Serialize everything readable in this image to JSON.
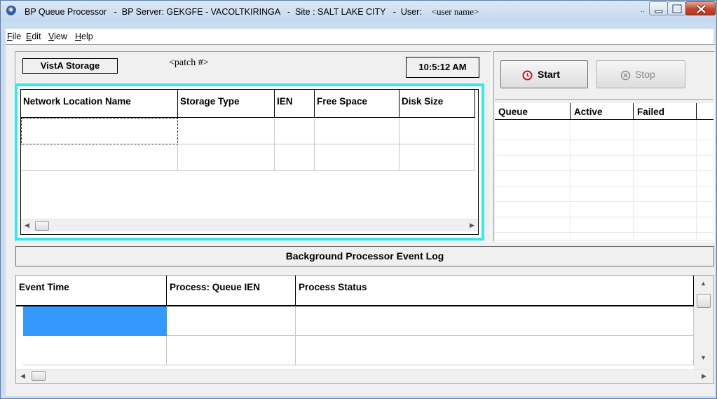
{
  "window": {
    "app_name": "BP Queue Processor",
    "server_label": "BP Server: GEKGFE - VACOLTKIRINGA",
    "site_label": "Site : SALT LAKE CITY",
    "user_label": "User:",
    "user_value": "<user name>",
    "separator": "-"
  },
  "menu": {
    "items": [
      {
        "key": "F",
        "rest": "ile"
      },
      {
        "key": "E",
        "rest": "dit"
      },
      {
        "key": "V",
        "rest": "iew"
      },
      {
        "key": "H",
        "rest": "elp"
      }
    ]
  },
  "storage": {
    "label": "VistA Storage",
    "patch": "<patch #>",
    "time": "10:5:12 AM",
    "columns": [
      "Network Location Name",
      "Storage Type",
      "IEN",
      "Free Space",
      "Disk Size"
    ]
  },
  "queue": {
    "start_label": "Start",
    "stop_label": "Stop",
    "columns": [
      "Queue",
      "Active",
      "Failed"
    ]
  },
  "event_log": {
    "title": "Background Processor Event Log",
    "columns": [
      "Event Time",
      "Process: Queue IEN",
      "Process Status"
    ]
  },
  "colors": {
    "grid_focus_border": "#33e8f0",
    "selected_cell": "#3399ff",
    "close_button": "#c2452a"
  },
  "icons": [
    "app-icon",
    "start-icon",
    "stop-icon",
    "minimize-icon",
    "maximize-icon",
    "close-icon"
  ]
}
